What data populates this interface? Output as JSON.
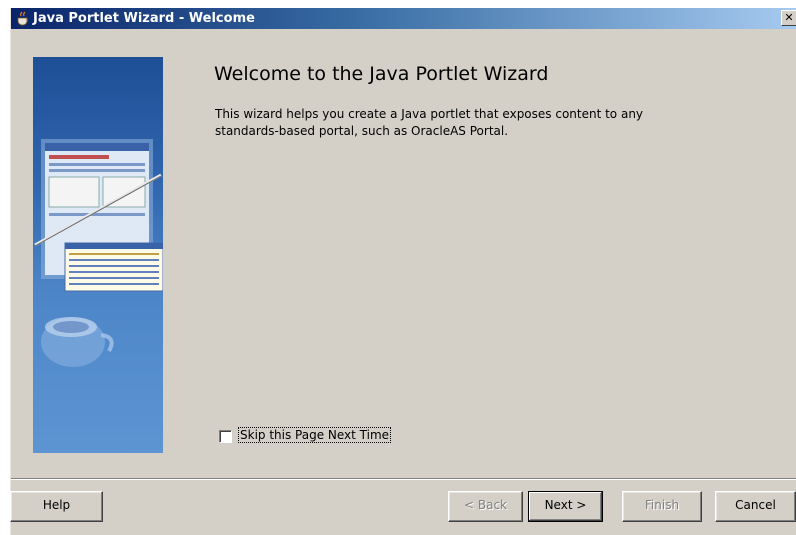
{
  "window": {
    "title": "Java Portlet Wizard - Welcome",
    "close_label": "✕"
  },
  "page": {
    "heading": "Welcome to the Java Portlet Wizard",
    "description": "This wizard helps you create a Java portlet that exposes content to any standards-based portal, such as OracleAS Portal."
  },
  "skip": {
    "label": "Skip this Page Next Time",
    "checked": false
  },
  "buttons": {
    "help": "Help",
    "back": "< Back",
    "next": "Next >",
    "finish": "Finish",
    "cancel": "Cancel"
  },
  "colors": {
    "titlebar_start": "#0a246a",
    "titlebar_end": "#a6caf0",
    "dialog_bg": "#d4d0c8",
    "banner_blue": "#2f64ad"
  }
}
